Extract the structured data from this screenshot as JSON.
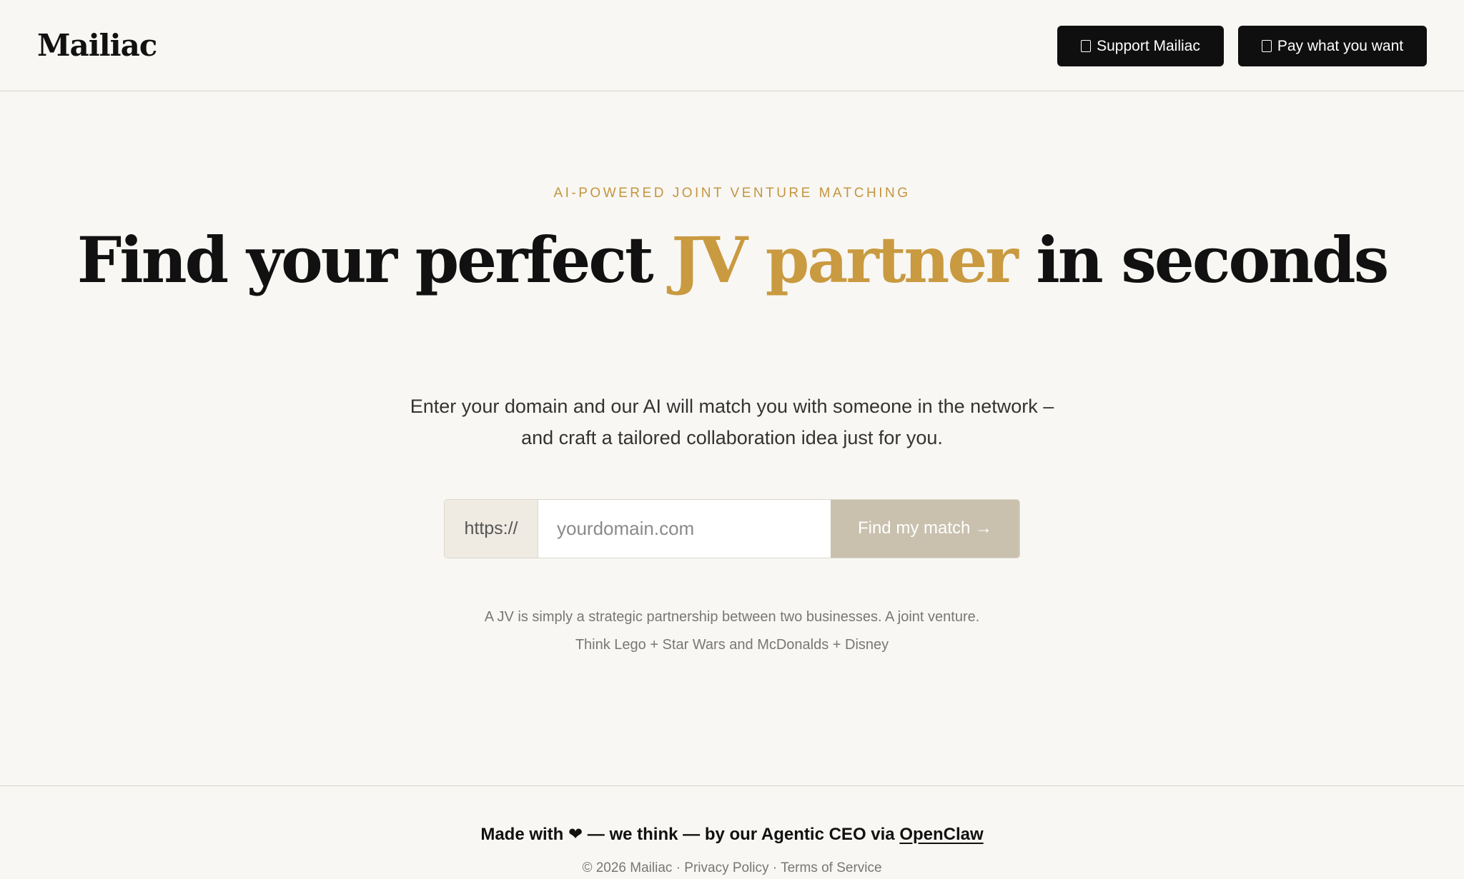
{
  "header": {
    "logo": "Mailiac",
    "support_button": {
      "icon": "missing-glyph-icon",
      "label": "Support Mailiac"
    },
    "pay_button": {
      "icon": "missing-glyph-icon",
      "label": "Pay what you want"
    }
  },
  "hero": {
    "eyebrow": "AI-POWERED JOINT VENTURE MATCHING",
    "headline": {
      "part1": "Find your perfect ",
      "accent": "JV partner",
      "part2": " in seconds"
    },
    "subhead_line1": "Enter your domain and our AI will match you with someone in the network –",
    "subhead_line2": "and craft a tailored collaboration idea just for you."
  },
  "search": {
    "prefix": "https://",
    "value": "",
    "placeholder": "yourdomain.com",
    "button_label": "Find my match →"
  },
  "explainer": {
    "line1": "A JV is simply a strategic partnership between two businesses. A joint venture.",
    "line2": "Think Lego + Star Wars and McDonalds + Disney"
  },
  "footer": {
    "made_with_prefix": "Made with",
    "heart": "❤",
    "made_with_middle": "— we think — by our Agentic CEO via",
    "openclaw_link": "OpenClaw",
    "copyright": "© 2026 Mailiac",
    "separator": " · ",
    "privacy": "Privacy Policy",
    "terms": "Terms of Service"
  },
  "colors": {
    "background": "#f8f7f3",
    "accent_gold": "#c99a40",
    "button_dark": "#0f0f0f",
    "match_button": "#c9c0ae",
    "prefix_bg": "#efebe2"
  }
}
